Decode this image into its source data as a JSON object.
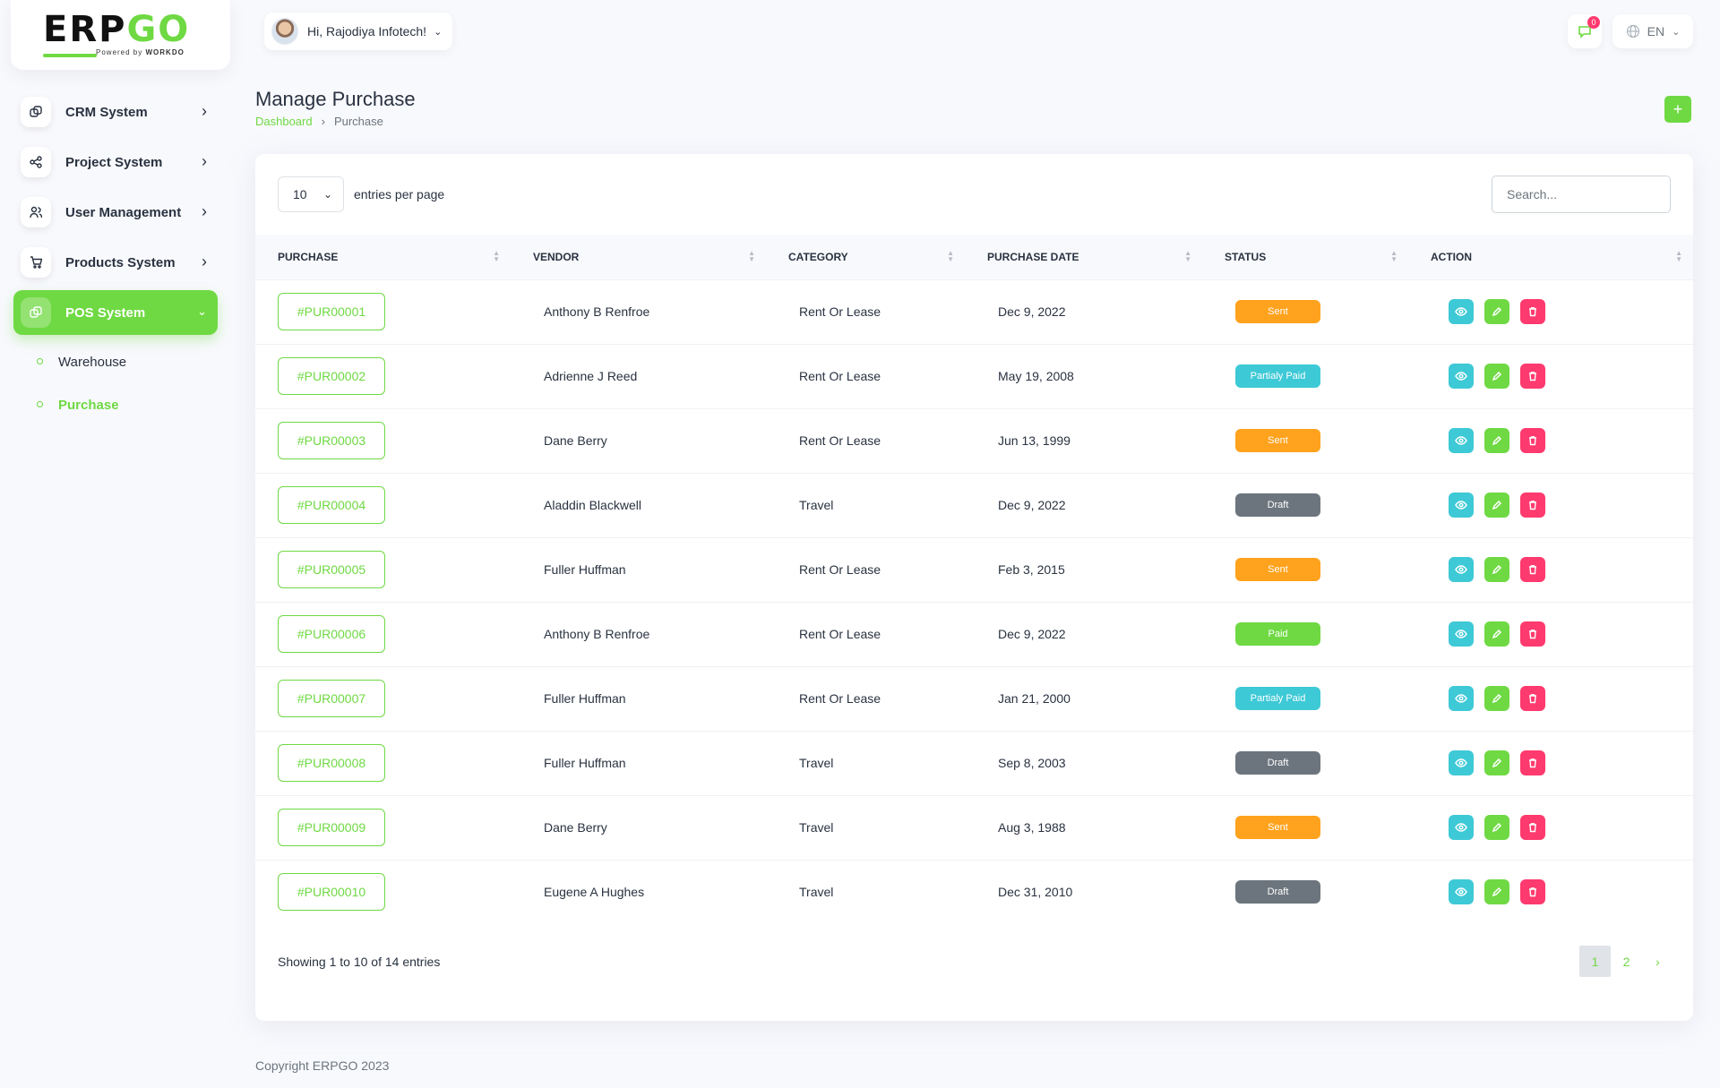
{
  "brand": {
    "logo_main": "ERP",
    "logo_accent": "GO",
    "powered_by": "Powered by",
    "powered_by_brand": "WORKDO"
  },
  "header": {
    "greeting": "Hi, Rajodiya Infotech!",
    "notification_count": "0",
    "language": "EN"
  },
  "sidebar": {
    "items": [
      {
        "label": "CRM System",
        "icon": "crm-icon"
      },
      {
        "label": "Project System",
        "icon": "share-icon"
      },
      {
        "label": "User Management",
        "icon": "users-icon"
      },
      {
        "label": "Products System",
        "icon": "cart-icon"
      },
      {
        "label": "POS System",
        "icon": "pos-icon",
        "active": true
      }
    ],
    "sub_items": [
      {
        "label": "Warehouse"
      },
      {
        "label": "Purchase",
        "current": true
      }
    ]
  },
  "page": {
    "title": "Manage Purchase",
    "breadcrumb": [
      "Dashboard",
      "Purchase"
    ],
    "add_label": "+"
  },
  "table": {
    "entries_value": "10",
    "entries_label": "entries per page",
    "search_placeholder": "Search...",
    "columns": [
      "PURCHASE",
      "VENDOR",
      "CATEGORY",
      "PURCHASE DATE",
      "STATUS",
      "ACTION"
    ],
    "rows": [
      {
        "purchase": "#PUR00001",
        "vendor": "Anthony B Renfroe",
        "category": "Rent Or Lease",
        "date": "Dec 9, 2022",
        "status": "Sent"
      },
      {
        "purchase": "#PUR00002",
        "vendor": "Adrienne J Reed",
        "category": "Rent Or Lease",
        "date": "May 19, 2008",
        "status": "Partialy Paid"
      },
      {
        "purchase": "#PUR00003",
        "vendor": "Dane Berry",
        "category": "Rent Or Lease",
        "date": "Jun 13, 1999",
        "status": "Sent"
      },
      {
        "purchase": "#PUR00004",
        "vendor": "Aladdin Blackwell",
        "category": "Travel",
        "date": "Dec 9, 2022",
        "status": "Draft"
      },
      {
        "purchase": "#PUR00005",
        "vendor": "Fuller Huffman",
        "category": "Rent Or Lease",
        "date": "Feb 3, 2015",
        "status": "Sent"
      },
      {
        "purchase": "#PUR00006",
        "vendor": "Anthony B Renfroe",
        "category": "Rent Or Lease",
        "date": "Dec 9, 2022",
        "status": "Paid"
      },
      {
        "purchase": "#PUR00007",
        "vendor": "Fuller Huffman",
        "category": "Rent Or Lease",
        "date": "Jan 21, 2000",
        "status": "Partialy Paid"
      },
      {
        "purchase": "#PUR00008",
        "vendor": "Fuller Huffman",
        "category": "Travel",
        "date": "Sep 8, 2003",
        "status": "Draft"
      },
      {
        "purchase": "#PUR00009",
        "vendor": "Dane Berry",
        "category": "Travel",
        "date": "Aug 3, 1988",
        "status": "Sent"
      },
      {
        "purchase": "#PUR00010",
        "vendor": "Eugene A Hughes",
        "category": "Travel",
        "date": "Dec 31, 2010",
        "status": "Draft"
      }
    ],
    "showing": "Showing 1 to 10 of 14 entries",
    "pages": [
      "1",
      "2",
      "›"
    ]
  },
  "status_colors": {
    "Sent": "#ffa21d",
    "Partialy Paid": "#3ec9d6",
    "Draft": "#6c757d",
    "Paid": "#6fd943"
  },
  "colors": {
    "accent": "#6fd943",
    "info": "#3ec9d6",
    "danger": "#ff3a6e"
  },
  "footer": {
    "copyright": "Copyright ERPGO 2023"
  }
}
